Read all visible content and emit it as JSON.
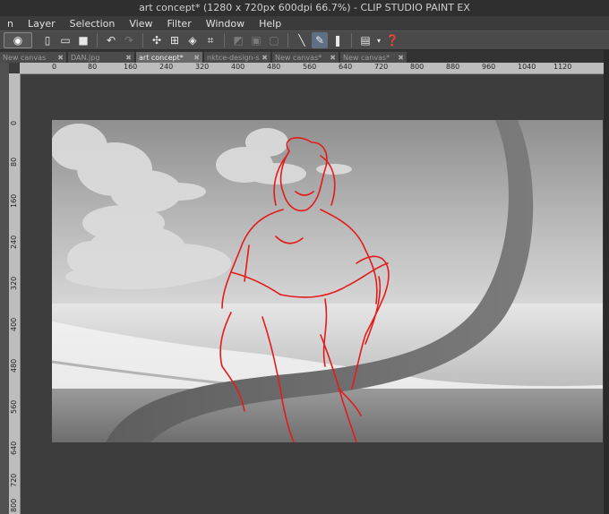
{
  "window": {
    "title": "art concept* (1280 x 720px 600dpi 66.7%) - CLIP STUDIO PAINT EX"
  },
  "menu": [
    "n",
    "Layer",
    "Selection",
    "View",
    "Filter",
    "Window",
    "Help"
  ],
  "toolbar": {
    "icons": [
      "logo-icon",
      "new-file-icon",
      "open-file-icon",
      "save-icon",
      "undo-icon",
      "redo-icon",
      "transform-icon",
      "select-all-icon",
      "fill-icon",
      "crop-icon",
      "layer-a-icon",
      "layer-b-icon",
      "layer-c-icon",
      "vector-pen-icon",
      "active-pen-icon",
      "pen-tablet-icon",
      "display-icon",
      "help-icon"
    ]
  },
  "tabs": [
    {
      "label": "New canvas",
      "active": false
    },
    {
      "label": "DAN.jpg",
      "active": false
    },
    {
      "label": "art concept*",
      "active": true
    },
    {
      "label": "nktce-design-s",
      "active": false
    },
    {
      "label": "New canvas*",
      "active": false
    },
    {
      "label": "New canvas*",
      "active": false
    }
  ],
  "ruler": {
    "h_ticks": [
      "0",
      "80",
      "160",
      "240",
      "320",
      "400",
      "480",
      "560",
      "640",
      "720",
      "800",
      "880",
      "960",
      "1040",
      "1120"
    ],
    "v_ticks": [
      "0",
      "80",
      "160",
      "240",
      "320",
      "400",
      "480",
      "560",
      "640",
      "720",
      "800"
    ]
  },
  "colors": {
    "sketch": "#e31b1b",
    "workspace": "#3d3d3d"
  }
}
